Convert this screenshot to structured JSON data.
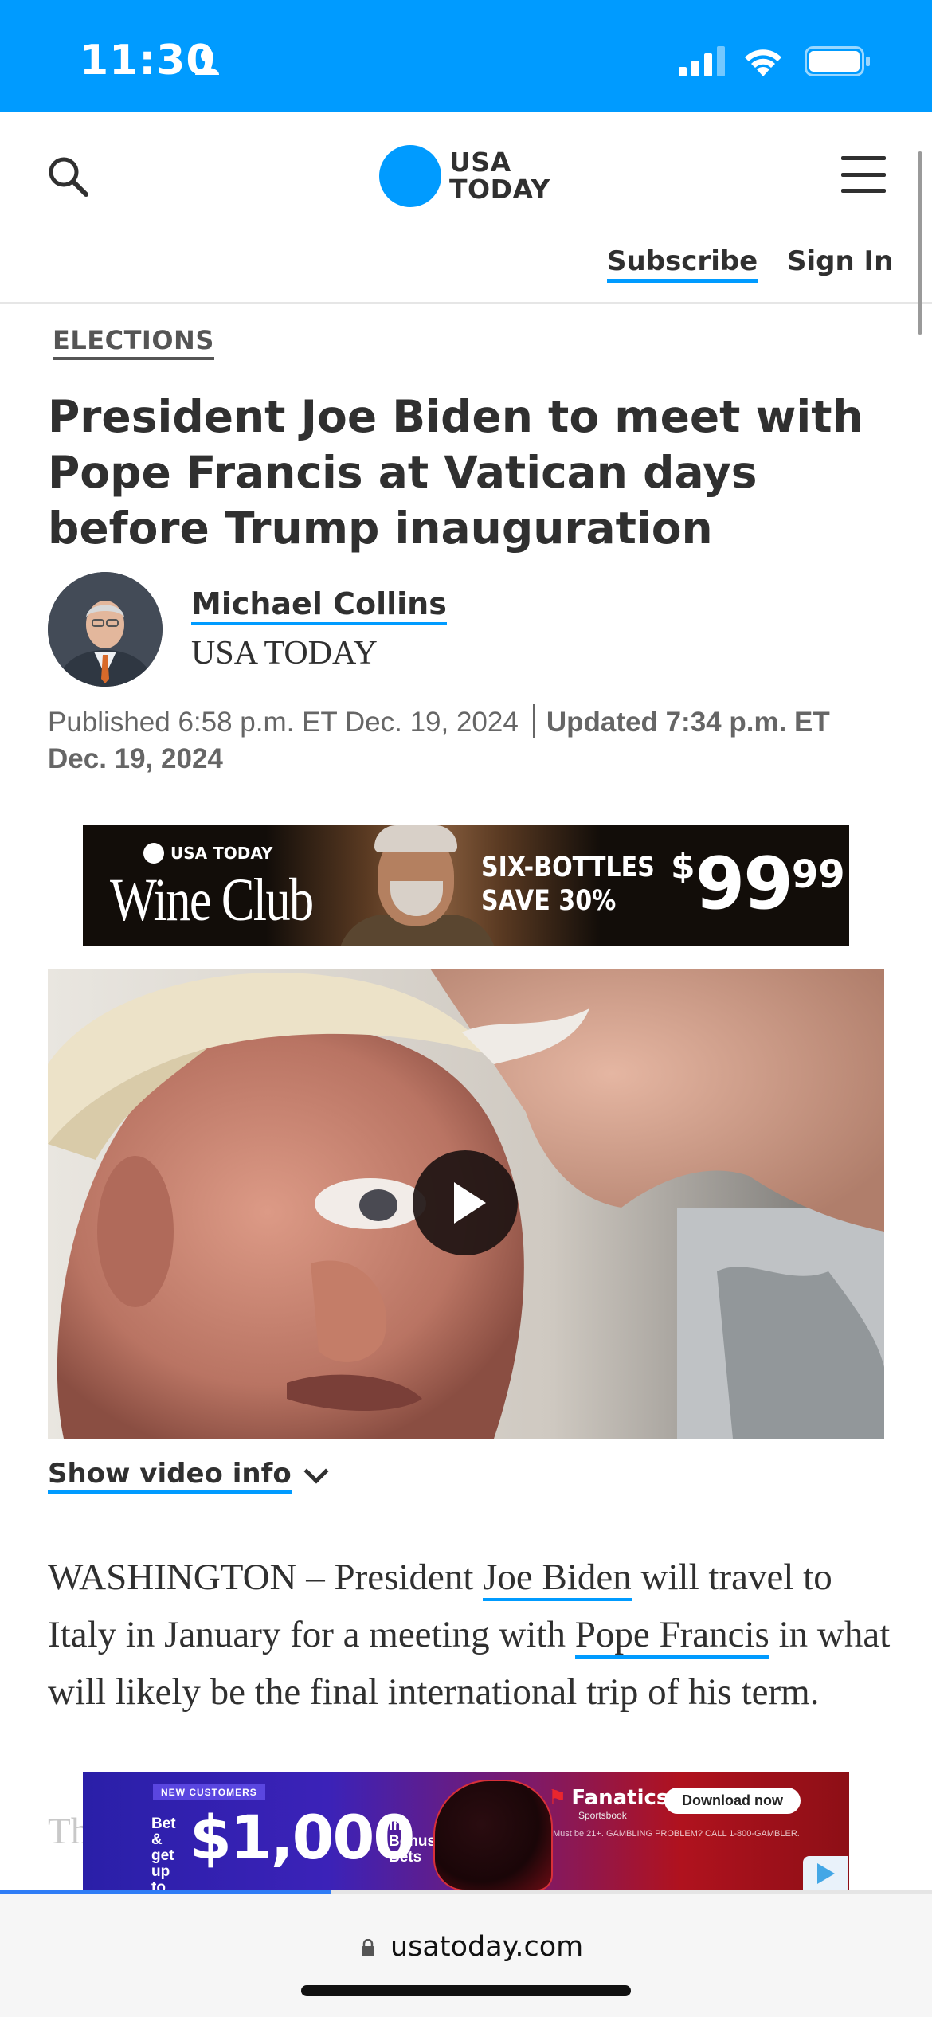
{
  "status_bar": {
    "time": "11:30",
    "icons": [
      "person-icon",
      "signal-icon",
      "wifi-icon",
      "battery-icon"
    ]
  },
  "header": {
    "logo_line1": "USA",
    "logo_line2": "TODAY",
    "subscribe_label": "Subscribe",
    "signin_label": "Sign In",
    "brand_color": "#009bff"
  },
  "article": {
    "kicker": "ELECTIONS",
    "headline": "President Joe Biden to meet with Pope Francis at Vatican days before Trump inauguration",
    "author_name": "Michael Collins",
    "author_org": "USA TODAY",
    "published": "Published 6:58 p.m. ET Dec. 19, 2024",
    "updated": "Updated 7:34 p.m. ET Dec. 19, 2024",
    "video_info_label": "Show video info",
    "body": {
      "p1_a": "WASHINGTON – President ",
      "link_biden": "Joe Biden",
      "p1_b": " will travel to Italy in January for a meeting with ",
      "link_pope": "Pope Francis",
      "p1_c": " in what will likely be the final international trip of his term."
    },
    "faded_start": "Th"
  },
  "ads": {
    "wine": {
      "brand": "USA TODAY",
      "title": "Wine Club",
      "offer_line1": "SIX-BOTTLES",
      "offer_line2": "SAVE 30%",
      "price_symbol": "$",
      "price_whole": "99",
      "price_cents": "99"
    },
    "fanatics": {
      "tag": "NEW CUSTOMERS",
      "bet_text": "Bet & get up to",
      "amount": "$1,000",
      "bonus_text": "in Bonus Bets",
      "brand": "Fanatics",
      "brand_sub": "Sportsbook",
      "cta": "Download now",
      "fine_print": "Must be 21+. GAMBLING PROBLEM? CALL 1-800-GAMBLER."
    }
  },
  "browser": {
    "url": "usatoday.com",
    "load_progress": 0.355
  }
}
